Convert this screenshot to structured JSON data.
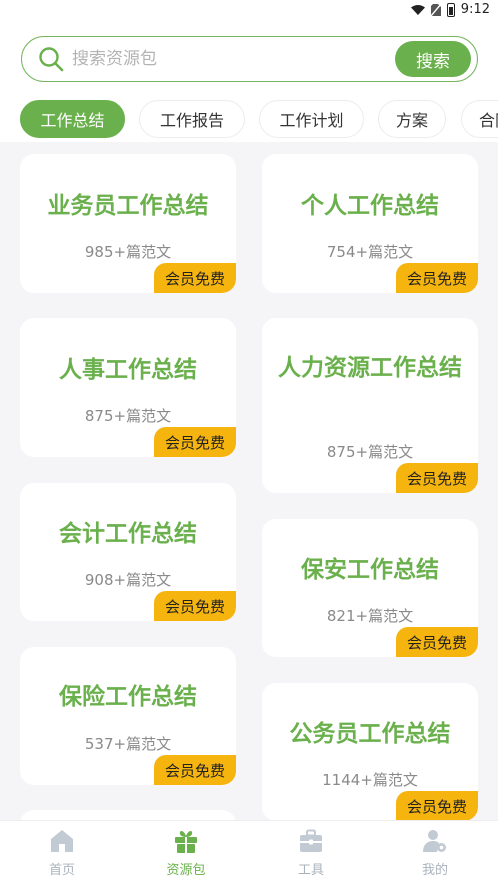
{
  "status": {
    "time": "9:12"
  },
  "search": {
    "placeholder": "搜索资源包",
    "button_label": "搜索"
  },
  "tabs": [
    {
      "label": "工作总结",
      "active": true
    },
    {
      "label": "工作报告",
      "active": false
    },
    {
      "label": "工作计划",
      "active": false
    },
    {
      "label": "方案",
      "active": false
    },
    {
      "label": "合同",
      "active": false
    }
  ],
  "cards": [
    {
      "title": "业务员工作总结",
      "count": "985+篇范文",
      "badge": "会员免费"
    },
    {
      "title": "个人工作总结",
      "count": "754+篇范文",
      "badge": "会员免费"
    },
    {
      "title": "人事工作总结",
      "count": "875+篇范文",
      "badge": "会员免费"
    },
    {
      "title": "人力资源工作总结",
      "count": "875+篇范文",
      "badge": "会员免费"
    },
    {
      "title": "会计工作总结",
      "count": "908+篇范文",
      "badge": "会员免费"
    },
    {
      "title": "保安工作总结",
      "count": "821+篇范文",
      "badge": "会员免费"
    },
    {
      "title": "保险工作总结",
      "count": "537+篇范文",
      "badge": "会员免费"
    },
    {
      "title": "公务员工作总结",
      "count": "1144+篇范文",
      "badge": "会员免费"
    }
  ],
  "bottom_nav": [
    {
      "label": "首页",
      "icon": "home-icon",
      "active": false
    },
    {
      "label": "资源包",
      "icon": "gift-icon",
      "active": true
    },
    {
      "label": "工具",
      "icon": "toolbox-icon",
      "active": false
    },
    {
      "label": "我的",
      "icon": "user-settings-icon",
      "active": false
    }
  ],
  "colors": {
    "accent": "#6ab04c",
    "badge": "#f6b50e",
    "nav_inactive": "#aab3bd",
    "background": "#f5f5f7"
  }
}
